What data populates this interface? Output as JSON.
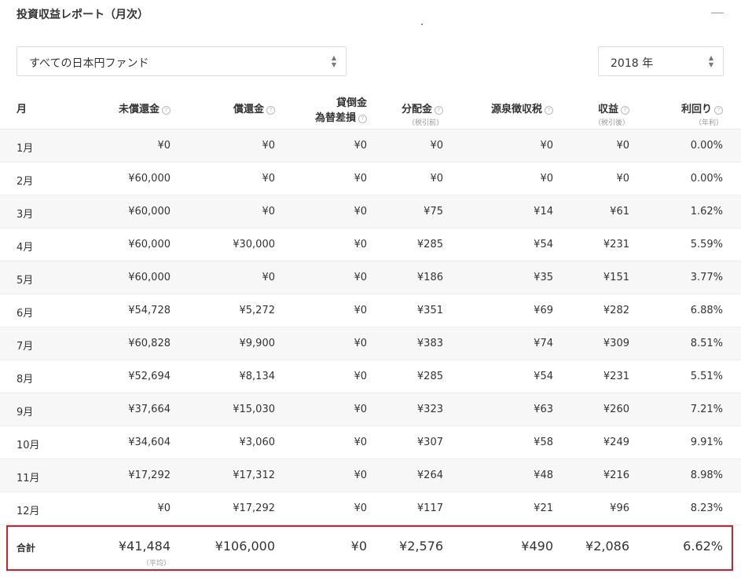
{
  "header": {
    "title": "投資収益レポート（月次）"
  },
  "filters": {
    "fund": "すべての日本円ファンド",
    "year": "2018 年",
    "arrow_glyphs": {
      "up": "▲",
      "down": "▼"
    }
  },
  "table": {
    "columns": [
      {
        "label": "月",
        "sub": "",
        "help": false
      },
      {
        "label": "未償還金",
        "sub": "",
        "help": true
      },
      {
        "label": "償還金",
        "sub": "",
        "help": true
      },
      {
        "label": "貸倒金",
        "label2": "為替差損",
        "sub": "",
        "help": true
      },
      {
        "label": "分配金",
        "sub": "（税引前）",
        "help": true
      },
      {
        "label": "源泉徴収税",
        "sub": "",
        "help": true
      },
      {
        "label": "収益",
        "sub": "（税引後）",
        "help": true
      },
      {
        "label": "利回り",
        "sub": "（年利）",
        "help": true
      }
    ],
    "help_glyph": "?",
    "rows": [
      [
        "1月",
        "¥0",
        "¥0",
        "¥0",
        "¥0",
        "¥0",
        "¥0",
        "0.00%"
      ],
      [
        "2月",
        "¥60,000",
        "¥0",
        "¥0",
        "¥0",
        "¥0",
        "¥0",
        "0.00%"
      ],
      [
        "3月",
        "¥60,000",
        "¥0",
        "¥0",
        "¥75",
        "¥14",
        "¥61",
        "1.62%"
      ],
      [
        "4月",
        "¥60,000",
        "¥30,000",
        "¥0",
        "¥285",
        "¥54",
        "¥231",
        "5.59%"
      ],
      [
        "5月",
        "¥60,000",
        "¥0",
        "¥0",
        "¥186",
        "¥35",
        "¥151",
        "3.77%"
      ],
      [
        "6月",
        "¥54,728",
        "¥5,272",
        "¥0",
        "¥351",
        "¥69",
        "¥282",
        "6.88%"
      ],
      [
        "7月",
        "¥60,828",
        "¥9,900",
        "¥0",
        "¥383",
        "¥74",
        "¥309",
        "8.51%"
      ],
      [
        "8月",
        "¥52,694",
        "¥8,134",
        "¥0",
        "¥285",
        "¥54",
        "¥231",
        "5.51%"
      ],
      [
        "9月",
        "¥37,664",
        "¥15,030",
        "¥0",
        "¥323",
        "¥63",
        "¥260",
        "7.21%"
      ],
      [
        "10月",
        "¥34,604",
        "¥3,060",
        "¥0",
        "¥307",
        "¥58",
        "¥249",
        "9.91%"
      ],
      [
        "11月",
        "¥17,292",
        "¥17,312",
        "¥0",
        "¥264",
        "¥48",
        "¥216",
        "8.98%"
      ],
      [
        "12月",
        "¥0",
        "¥17,292",
        "¥0",
        "¥117",
        "¥21",
        "¥96",
        "8.23%"
      ]
    ],
    "total": {
      "label": "合計",
      "values": [
        "¥41,484",
        "¥106,000",
        "¥0",
        "¥2,576",
        "¥490",
        "¥2,086",
        "6.62%"
      ],
      "note": "（平均）"
    },
    "highlight_color": "#d0202e"
  }
}
